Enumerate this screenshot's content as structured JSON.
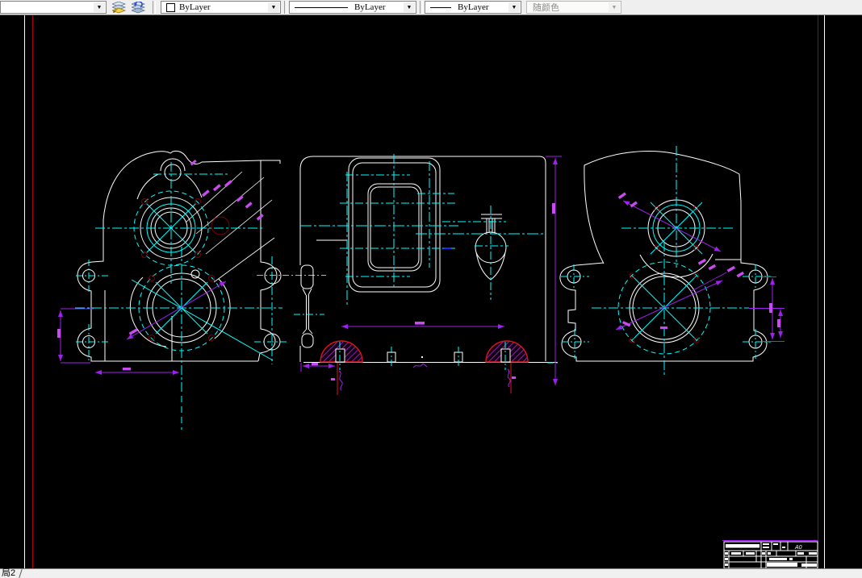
{
  "toolbar": {
    "layer_value": "",
    "color": {
      "value": "ByLayer"
    },
    "linetype": {
      "value": "ByLayer"
    },
    "lineweight": {
      "value": "ByLayer"
    },
    "plot_style": {
      "value": "随颜色"
    }
  },
  "tabs": {
    "active_label": "局2"
  },
  "title_block": {
    "size_label": "A0"
  },
  "colors": {
    "canvas": "#000000",
    "toolbar_bg": "#efefef",
    "line_white": "#ffffff",
    "centerline_cyan": "#00ffff",
    "dimension_purple": "#a020f0",
    "annotation_magenta": "#c84bf0",
    "section_red": "#de1414",
    "hatch_purple": "#a226c4",
    "detail_dark_red": "#7a0008",
    "frame_red": "#a80014",
    "highlight_blue": "#2222ff"
  }
}
